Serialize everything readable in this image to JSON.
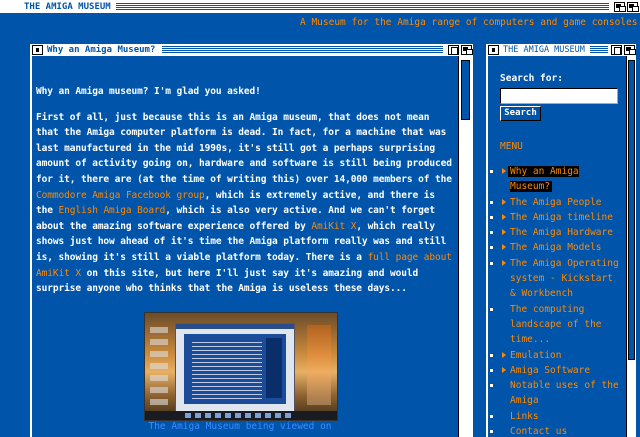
{
  "screen": {
    "title": "THE AMIGA MUSEUM",
    "tagline": "A Museum for the Amiga range of computers and game consoles."
  },
  "main_window": {
    "title": "Why an Amiga Museum?",
    "heading": "Why an Amiga museum?  I'm glad you asked!",
    "para_a": "First of all, just because this is an Amiga museum, that does not mean that the Amiga computer platform is dead.  In fact, for a machine that was last manufactured in the mid 1990s, it's still got a perhaps surprising amount of activity going on, hardware and software is still being produced for it, there are (at the time of writing this) over 14,000 members of the ",
    "link_facebook": "Commodore Amiga Facebook group",
    "para_b": ", which is extremely active, and there is the ",
    "link_board": "English Amiga Board",
    "para_c": ", which is also very active.  And we can't forget about the amazing software experience offered by ",
    "link_amikit": "AmiKit X",
    "para_d": ", which really shows just how ahead of it's time the Amiga platform really was and still is, showing it's still a viable platform today.  There is a ",
    "link_fullpage": "full page about AmiKit X",
    "para_e": " on this site, but here I'll just say it's amazing and would surprise anyone who thinks that the Amiga is useless these days...",
    "image_caption": "The Amiga Museum being viewed on"
  },
  "side_window": {
    "title": "THE AMIGA MUSEUM",
    "search_label": "Search for:",
    "search_value": "",
    "search_button": "Search",
    "menu_title": "MENU",
    "menu_items": [
      {
        "label": "Why an Amiga Museum?",
        "arrow": true,
        "active": true
      },
      {
        "label": "The Amiga People",
        "arrow": true,
        "active": false
      },
      {
        "label": "The Amiga timeline",
        "arrow": true,
        "active": false
      },
      {
        "label": "The Amiga Hardware",
        "arrow": true,
        "active": false
      },
      {
        "label": "The Amiga Models",
        "arrow": true,
        "active": false
      },
      {
        "label": "The Amiga Operating system - Kickstart & Workbench",
        "arrow": true,
        "active": false
      },
      {
        "label": "The computing landscape of the time...",
        "arrow": false,
        "active": false
      },
      {
        "label": "Emulation",
        "arrow": true,
        "active": false
      },
      {
        "label": "Amiga Software",
        "arrow": true,
        "active": false
      },
      {
        "label": "Notable uses of the Amiga",
        "arrow": false,
        "active": false
      },
      {
        "label": "Links",
        "arrow": false,
        "active": false
      },
      {
        "label": "Contact us",
        "arrow": false,
        "active": false
      }
    ]
  },
  "colors": {
    "background": "#0055aa",
    "text": "#ffffff",
    "accent": "#ff8800"
  }
}
